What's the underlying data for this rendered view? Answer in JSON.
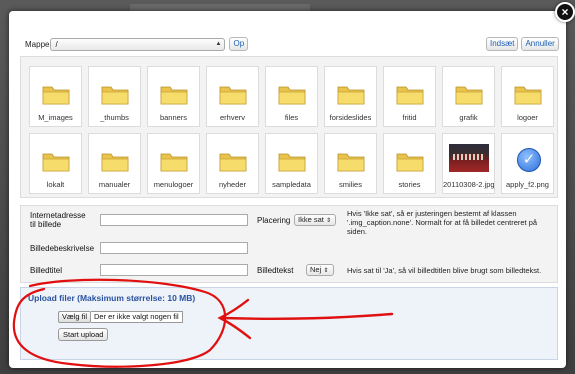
{
  "toolbar": {
    "folder_label": "Mappe",
    "folder_value": "/",
    "up_label": "Op",
    "insert_label": "Indsæt",
    "cancel_label": "Annuller"
  },
  "items": [
    {
      "name": "M_images",
      "kind": "folder"
    },
    {
      "name": "_thumbs",
      "kind": "folder"
    },
    {
      "name": "banners",
      "kind": "folder"
    },
    {
      "name": "erhverv",
      "kind": "folder"
    },
    {
      "name": "files",
      "kind": "folder"
    },
    {
      "name": "forsideslides",
      "kind": "folder"
    },
    {
      "name": "fritid",
      "kind": "folder"
    },
    {
      "name": "grafik",
      "kind": "folder"
    },
    {
      "name": "logoer",
      "kind": "folder"
    },
    {
      "name": "lokalt",
      "kind": "folder"
    },
    {
      "name": "manualer",
      "kind": "folder"
    },
    {
      "name": "menulogoer",
      "kind": "folder"
    },
    {
      "name": "nyheder",
      "kind": "folder"
    },
    {
      "name": "sampledata",
      "kind": "folder"
    },
    {
      "name": "smilies",
      "kind": "folder"
    },
    {
      "name": "stories",
      "kind": "folder"
    },
    {
      "name": "20110308-2.jpg",
      "kind": "photo"
    },
    {
      "name": "apply_f2.png",
      "kind": "check"
    }
  ],
  "form": {
    "url_label_1": "Internetadresse",
    "url_label_2": "til billede",
    "url_value": "",
    "placement_label": "Placering",
    "placement_value": "Ikke sat",
    "placement_help": "Hvis 'Ikke sat', så er justeringen bestemt af klassen '.img_caption.none'. Normalt for at få billedet centreret på siden.",
    "desc_label": "Billedebeskrivelse",
    "desc_value": "",
    "title_label": "Billedtitel",
    "title_value": "",
    "caption_label": "Billedtekst",
    "caption_value": "Nej",
    "caption_help": "Hvis sat til 'Ja', så vil billedtitlen blive brugt som billedtekst."
  },
  "upload": {
    "title": "Upload filer (Maksimum størrelse: 10 MB)",
    "choose_label": "Vælg fil",
    "status": "Der er ikke valgt nogen fil",
    "start_label": "Start upload"
  },
  "icons": {
    "close": "close-icon",
    "folder": "folder-icon",
    "select_arrows": "updown-arrows-icon"
  },
  "colors": {
    "accent_blue": "#1a5fb4",
    "upload_title": "#2a52a0",
    "annotation_red": "#e01010",
    "folder_fill": "#f6dc6a"
  }
}
